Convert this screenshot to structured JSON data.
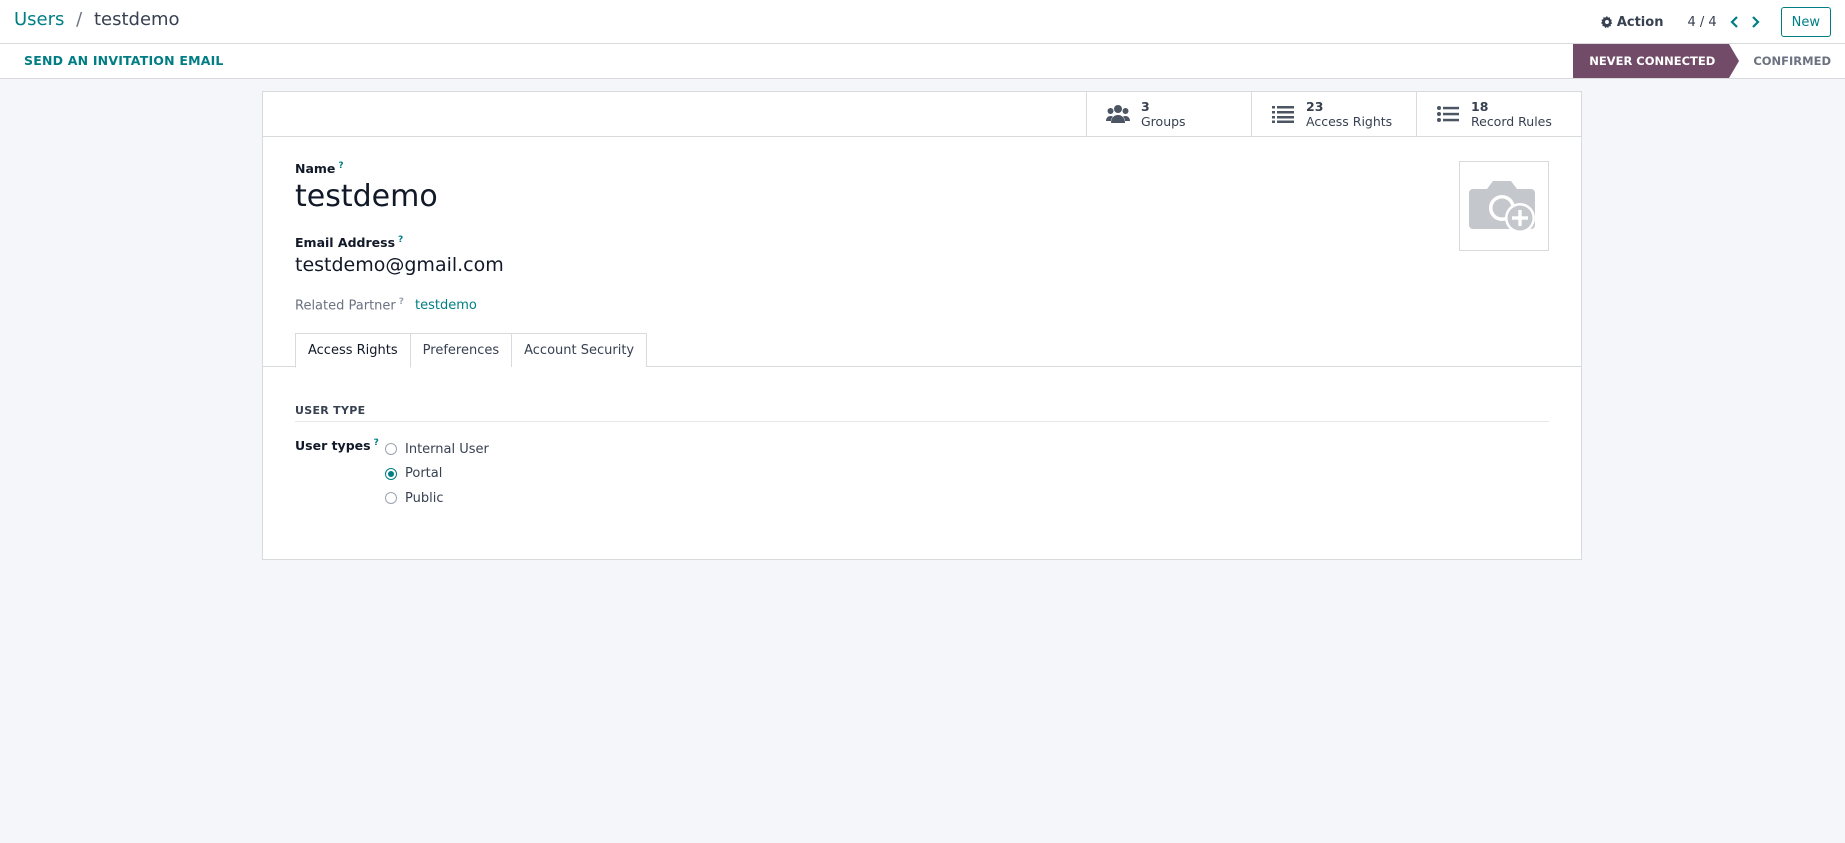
{
  "breadcrumb": {
    "parent": "Users",
    "separator": "/",
    "current": "testdemo"
  },
  "control_panel": {
    "action_label": "Action",
    "pager_value": "4 / 4",
    "new_label": "New"
  },
  "statusbar": {
    "invite_label": "SEND AN INVITATION EMAIL",
    "steps": [
      {
        "label": "NEVER CONNECTED",
        "active": true
      },
      {
        "label": "CONFIRMED",
        "active": false
      }
    ]
  },
  "smart_buttons": [
    {
      "value": "3",
      "label": "Groups",
      "icon": "users-icon"
    },
    {
      "value": "23",
      "label": "Access Rights",
      "icon": "list-icon"
    },
    {
      "value": "18",
      "label": "Record Rules",
      "icon": "list-icon"
    }
  ],
  "form": {
    "name_label": "Name",
    "name_value": "testdemo",
    "email_label": "Email Address",
    "email_value": "testdemo@gmail.com",
    "partner_label": "Related Partner",
    "partner_value": "testdemo",
    "help_marker": "?"
  },
  "tabs": [
    {
      "label": "Access Rights",
      "active": true
    },
    {
      "label": "Preferences",
      "active": false
    },
    {
      "label": "Account Security",
      "active": false
    }
  ],
  "access_rights": {
    "group_title": "USER TYPE",
    "user_types_label": "User types",
    "options": [
      {
        "label": "Internal User",
        "checked": false
      },
      {
        "label": "Portal",
        "checked": true
      },
      {
        "label": "Public",
        "checked": false
      }
    ]
  },
  "colors": {
    "accent": "#017e84",
    "status_active": "#714b67",
    "background": "#f5f6f9"
  }
}
